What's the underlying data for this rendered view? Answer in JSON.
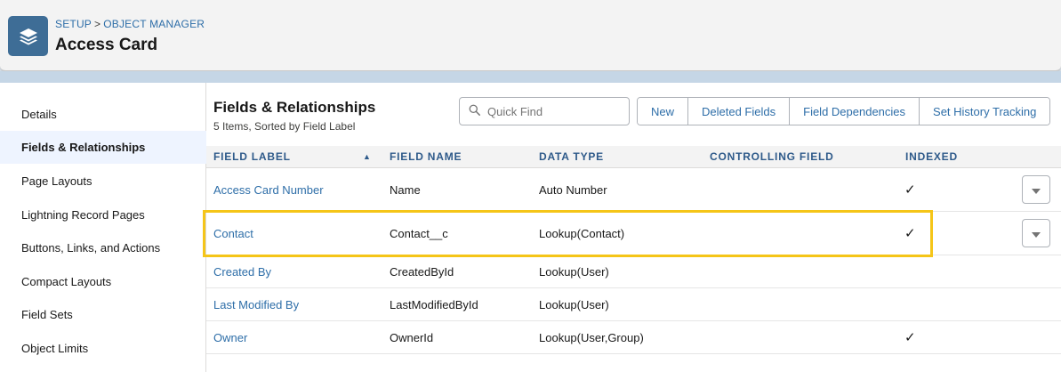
{
  "header": {
    "breadcrumb": [
      "SETUP",
      "OBJECT MANAGER"
    ],
    "breadcrumb_separator": ">",
    "title": "Access Card",
    "icon": "layers-icon"
  },
  "sidebar": {
    "items": [
      {
        "label": "Details",
        "active": false
      },
      {
        "label": "Fields & Relationships",
        "active": true
      },
      {
        "label": "Page Layouts",
        "active": false
      },
      {
        "label": "Lightning Record Pages",
        "active": false
      },
      {
        "label": "Buttons, Links, and Actions",
        "active": false
      },
      {
        "label": "Compact Layouts",
        "active": false
      },
      {
        "label": "Field Sets",
        "active": false
      },
      {
        "label": "Object Limits",
        "active": false
      }
    ]
  },
  "main": {
    "title": "Fields & Relationships",
    "subtitle": "5 Items, Sorted by Field Label",
    "search": {
      "placeholder": "Quick Find",
      "value": ""
    },
    "buttons": [
      "New",
      "Deleted Fields",
      "Field Dependencies",
      "Set History Tracking"
    ]
  },
  "table": {
    "columns": [
      "FIELD LABEL",
      "FIELD NAME",
      "DATA TYPE",
      "CONTROLLING FIELD",
      "INDEXED"
    ],
    "sort": {
      "column": "FIELD LABEL",
      "direction": "ascending"
    },
    "rows": [
      {
        "label": "Access Card Number",
        "name": "Name",
        "type": "Auto Number",
        "controlling": "",
        "indexed": true,
        "indexed_mark": "✓",
        "has_menu": true
      },
      {
        "label": "Contact",
        "name": "Contact__c",
        "type": "Lookup(Contact)",
        "controlling": "",
        "indexed": true,
        "indexed_mark": "✓",
        "has_menu": true
      },
      {
        "label": "Created By",
        "name": "CreatedById",
        "type": "Lookup(User)",
        "controlling": "",
        "indexed": false,
        "indexed_mark": "",
        "has_menu": false
      },
      {
        "label": "Last Modified By",
        "name": "LastModifiedById",
        "type": "Lookup(User)",
        "controlling": "",
        "indexed": false,
        "indexed_mark": "",
        "has_menu": false
      },
      {
        "label": "Owner",
        "name": "OwnerId",
        "type": "Lookup(User,Group)",
        "controlling": "",
        "indexed": true,
        "indexed_mark": "✓",
        "has_menu": false
      }
    ]
  },
  "colors": {
    "accent": "#2e6ea8",
    "highlight": "#f5c518",
    "header_icon_bg": "#3e6d96"
  }
}
